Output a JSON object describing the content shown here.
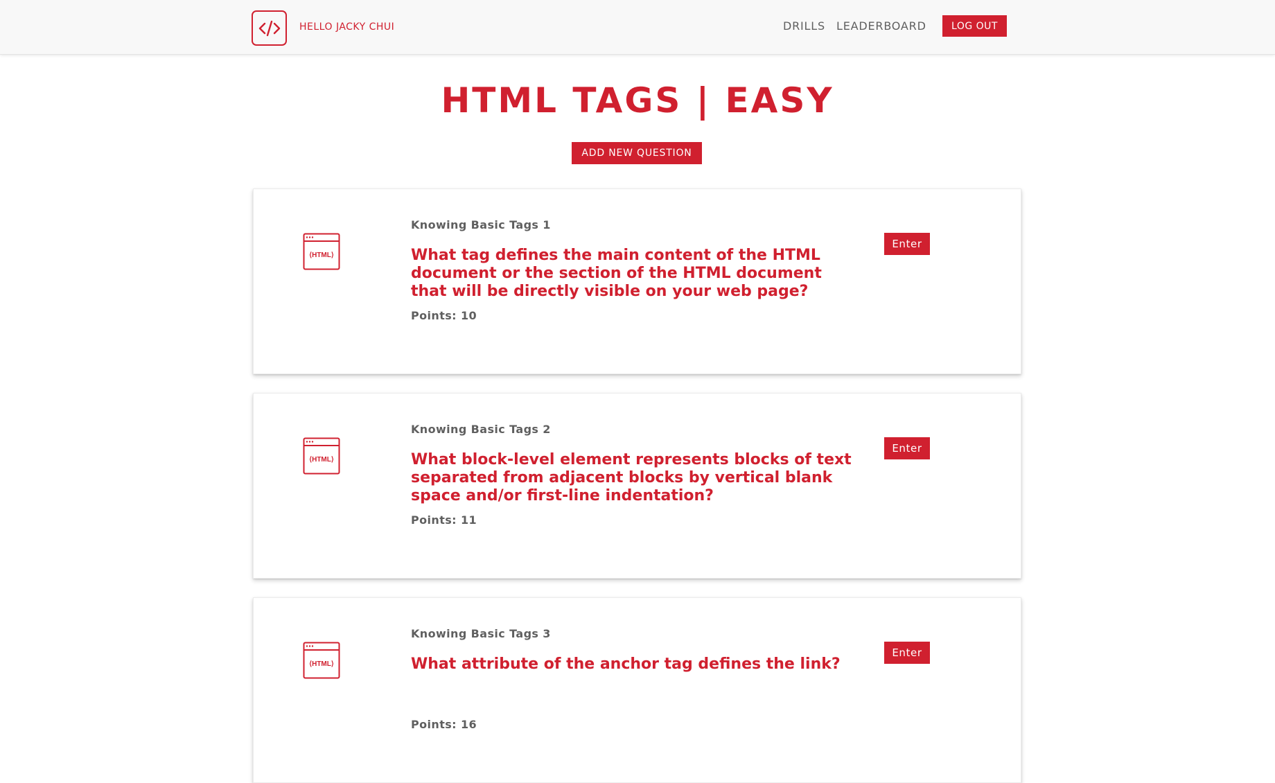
{
  "header": {
    "greeting": "HELLO JACKY CHUI",
    "nav": {
      "drills": "DRILLS",
      "leaderboard": "LEADERBOARD",
      "logout": "LOG OUT"
    },
    "logo_icon": "code-brackets-icon"
  },
  "main": {
    "title": "HTML TAGS | EASY",
    "add_question_label": "ADD NEW QUESTION"
  },
  "questions": [
    {
      "tag": "Knowing Basic Tags 1",
      "question": "What tag defines the main content of the HTML document or the section of the HTML document that will be directly visible on your web page?",
      "points_label": "Points:",
      "points": "10",
      "enter_label": "Enter",
      "icon": "html-window-icon"
    },
    {
      "tag": "Knowing Basic Tags 2",
      "question": "What block-level element represents blocks of text separated from adjacent blocks by vertical blank space and/or first-line indentation?",
      "points_label": "Points:",
      "points": "11",
      "enter_label": "Enter",
      "icon": "html-window-icon"
    },
    {
      "tag": "Knowing Basic Tags 3",
      "question": "What attribute of the anchor tag defines the link?",
      "points_label": "Points:",
      "points": "16",
      "enter_label": "Enter",
      "icon": "html-window-icon"
    }
  ],
  "colors": {
    "accent": "#d0202f",
    "text_gray": "#5f5f5f",
    "navbar_bg": "#f8f8f8"
  }
}
